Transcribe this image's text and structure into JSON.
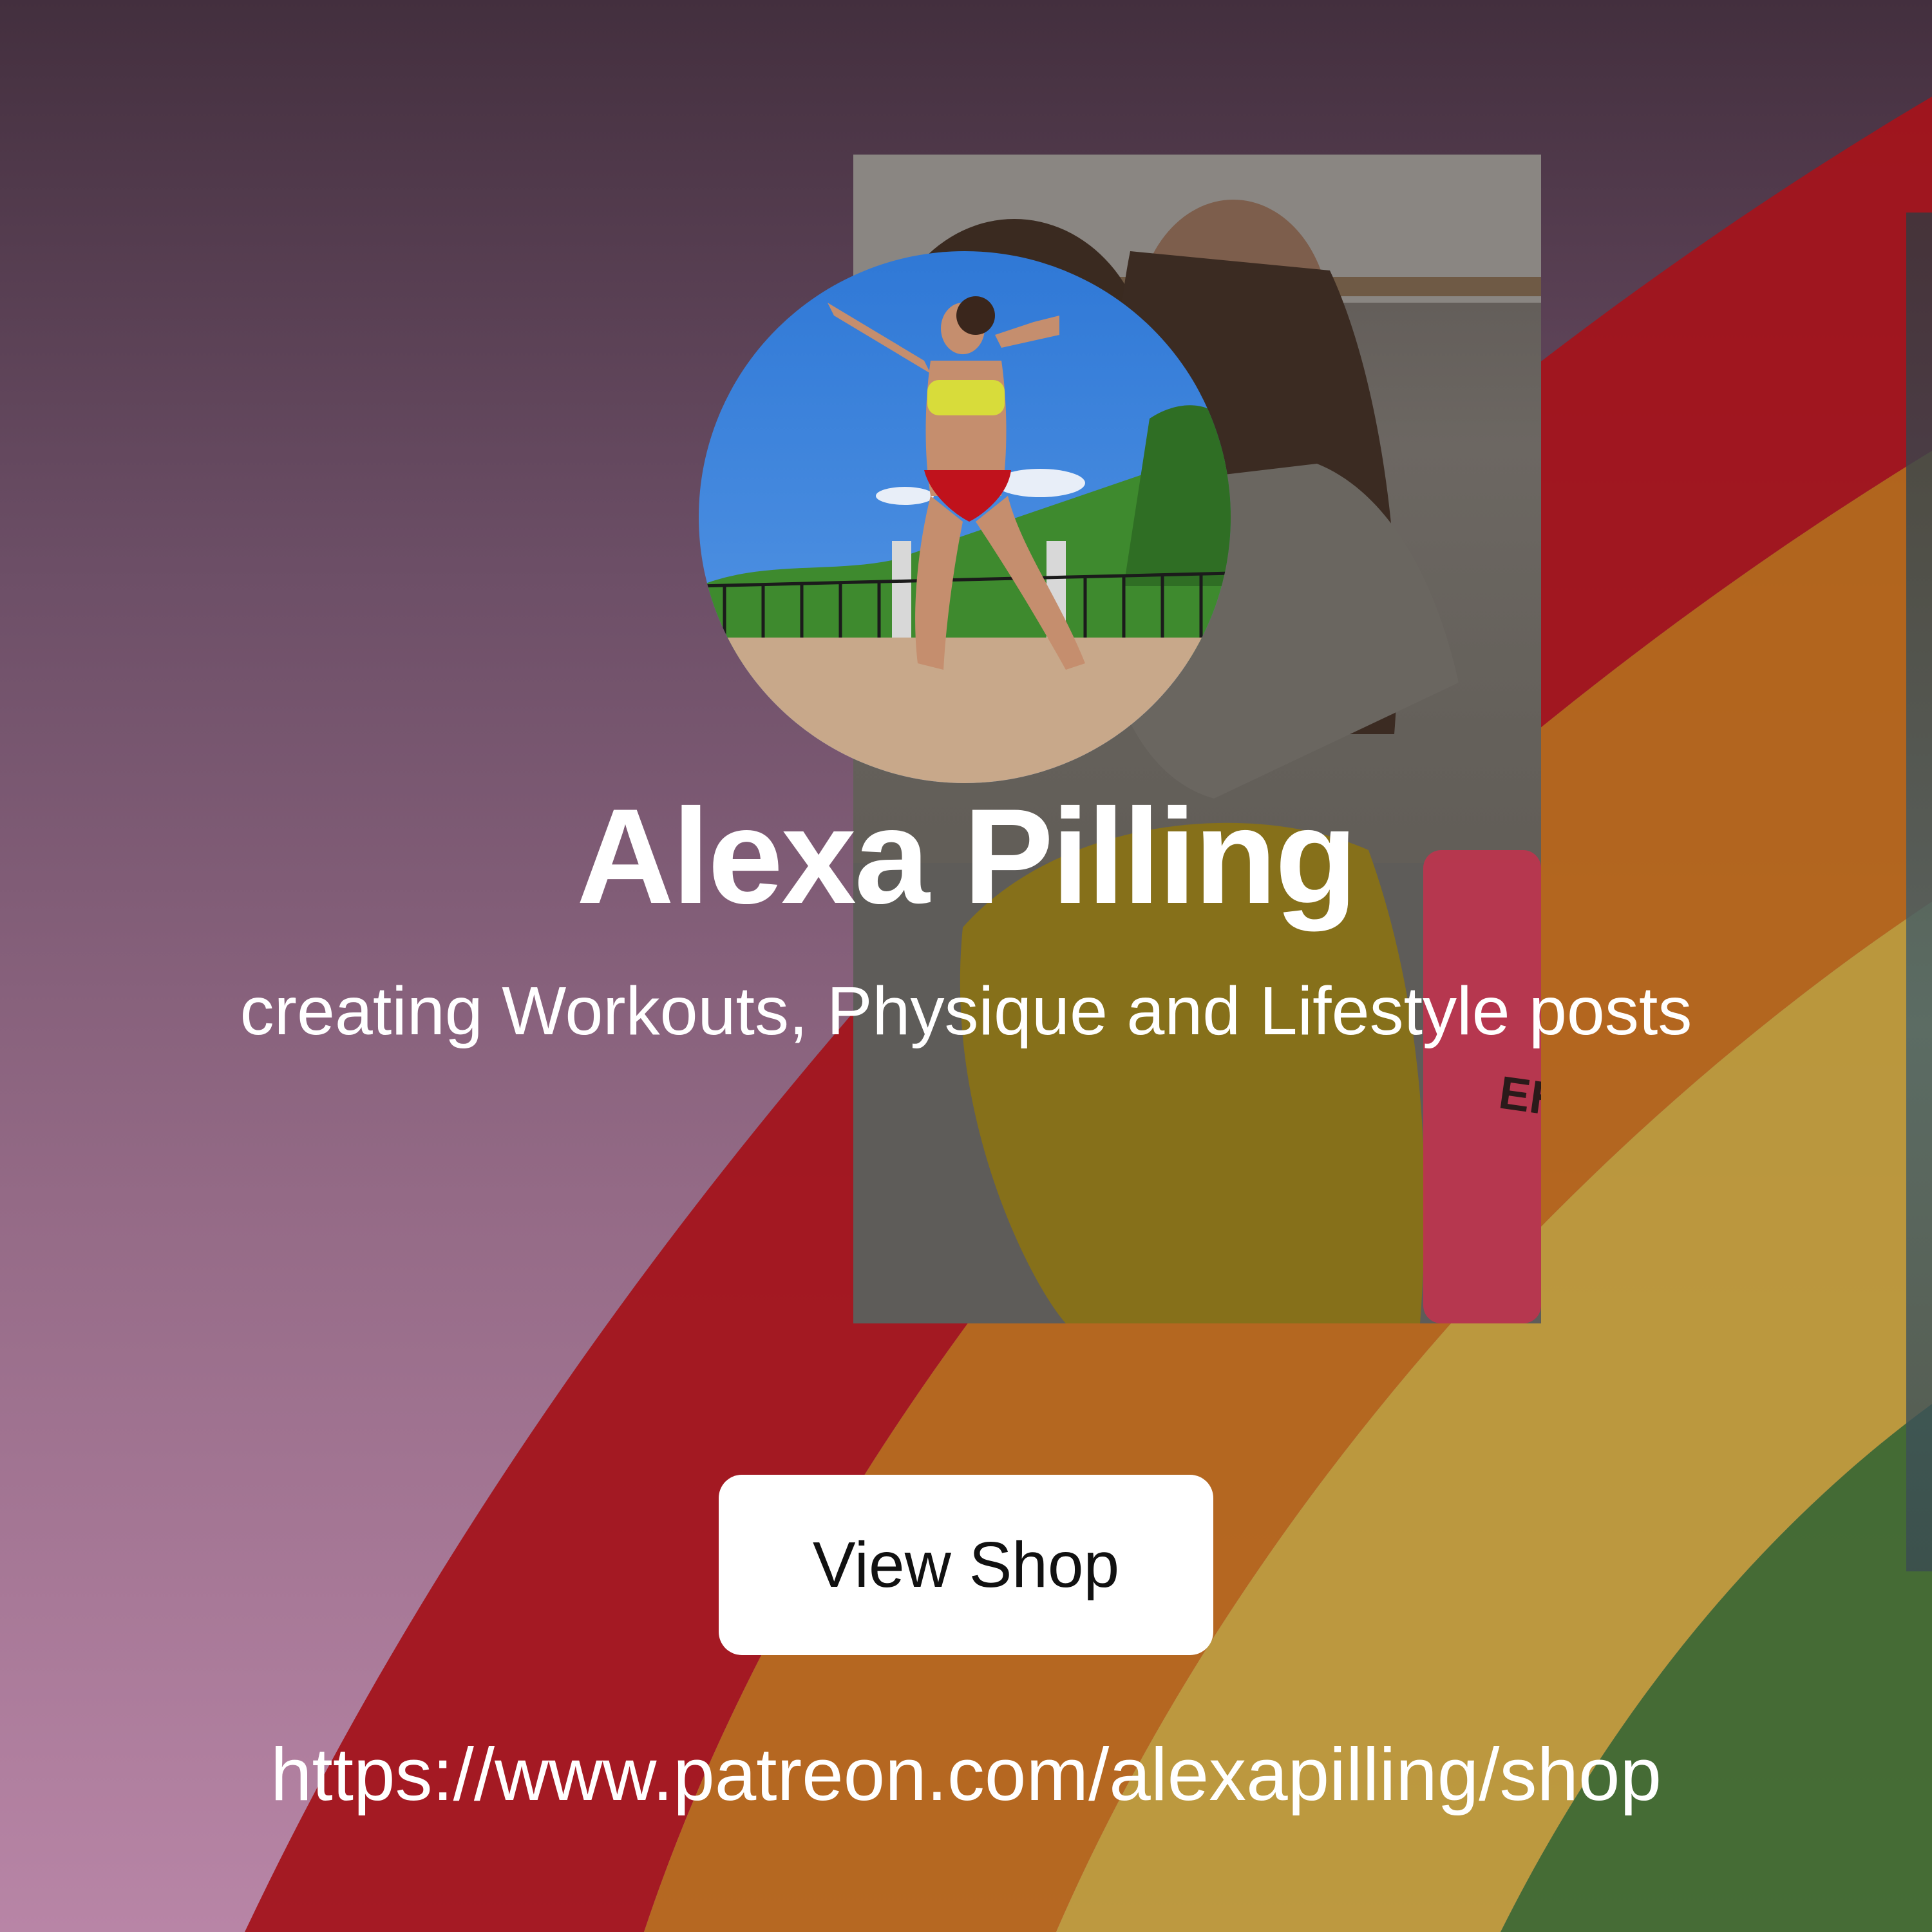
{
  "profile": {
    "name": "Alexa Pilling",
    "tagline": "creating Workouts, Physique and Lifestyle posts"
  },
  "actions": {
    "view_shop_label": "View Shop"
  },
  "link": {
    "url": "https://www.patreon.com/alexapilling/shop"
  },
  "background": {
    "gradient_top": "#432f3e",
    "gradient_bottom": "#b885a6",
    "rainbow_colors": [
      "#a3141c",
      "#b5661a",
      "#bd9a3a",
      "#3f6a2f"
    ],
    "bottle_label": "EHP"
  },
  "avatar": {
    "icon": "profile-photo"
  }
}
